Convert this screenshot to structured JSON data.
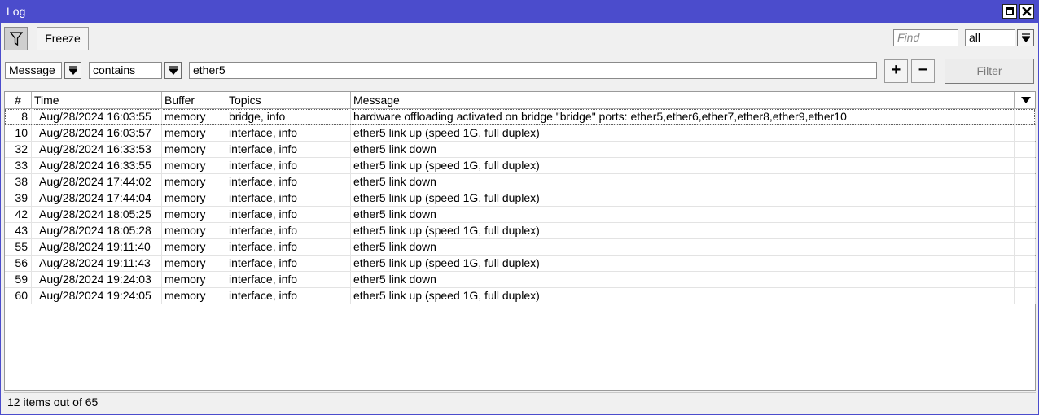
{
  "window": {
    "title": "Log"
  },
  "toolbar": {
    "freeze_label": "Freeze",
    "find_placeholder": "Find",
    "scope_value": "all"
  },
  "filter": {
    "field": "Message",
    "operator": "contains",
    "value": "ether5",
    "filter_label": "Filter",
    "add_label": "+",
    "remove_label": "−"
  },
  "table": {
    "columns": [
      "#",
      "Time",
      "Buffer",
      "Topics",
      "Message"
    ],
    "rows": [
      {
        "num": "8",
        "time": "Aug/28/2024 16:03:55",
        "buffer": "memory",
        "topics": "bridge, info",
        "message": "hardware offloading activated on bridge \"bridge\" ports: ether5,ether6,ether7,ether8,ether9,ether10"
      },
      {
        "num": "10",
        "time": "Aug/28/2024 16:03:57",
        "buffer": "memory",
        "topics": "interface, info",
        "message": "ether5 link up (speed 1G, full duplex)"
      },
      {
        "num": "32",
        "time": "Aug/28/2024 16:33:53",
        "buffer": "memory",
        "topics": "interface, info",
        "message": "ether5 link down"
      },
      {
        "num": "33",
        "time": "Aug/28/2024 16:33:55",
        "buffer": "memory",
        "topics": "interface, info",
        "message": "ether5 link up (speed 1G, full duplex)"
      },
      {
        "num": "38",
        "time": "Aug/28/2024 17:44:02",
        "buffer": "memory",
        "topics": "interface, info",
        "message": "ether5 link down"
      },
      {
        "num": "39",
        "time": "Aug/28/2024 17:44:04",
        "buffer": "memory",
        "topics": "interface, info",
        "message": "ether5 link up (speed 1G, full duplex)"
      },
      {
        "num": "42",
        "time": "Aug/28/2024 18:05:25",
        "buffer": "memory",
        "topics": "interface, info",
        "message": "ether5 link down"
      },
      {
        "num": "43",
        "time": "Aug/28/2024 18:05:28",
        "buffer": "memory",
        "topics": "interface, info",
        "message": "ether5 link up (speed 1G, full duplex)"
      },
      {
        "num": "55",
        "time": "Aug/28/2024 19:11:40",
        "buffer": "memory",
        "topics": "interface, info",
        "message": "ether5 link down"
      },
      {
        "num": "56",
        "time": "Aug/28/2024 19:11:43",
        "buffer": "memory",
        "topics": "interface, info",
        "message": "ether5 link up (speed 1G, full duplex)"
      },
      {
        "num": "59",
        "time": "Aug/28/2024 19:24:03",
        "buffer": "memory",
        "topics": "interface, info",
        "message": "ether5 link down"
      },
      {
        "num": "60",
        "time": "Aug/28/2024 19:24:05",
        "buffer": "memory",
        "topics": "interface, info",
        "message": "ether5 link up (speed 1G, full duplex)"
      }
    ]
  },
  "status": {
    "text": "12 items out of 65"
  },
  "icons": {
    "filter": "funnel-icon",
    "maximize": "maximize-icon",
    "close": "close-icon",
    "dropdown": "dropdown-arrow-icon"
  },
  "colors": {
    "titlebar": "#4b4ccc"
  }
}
